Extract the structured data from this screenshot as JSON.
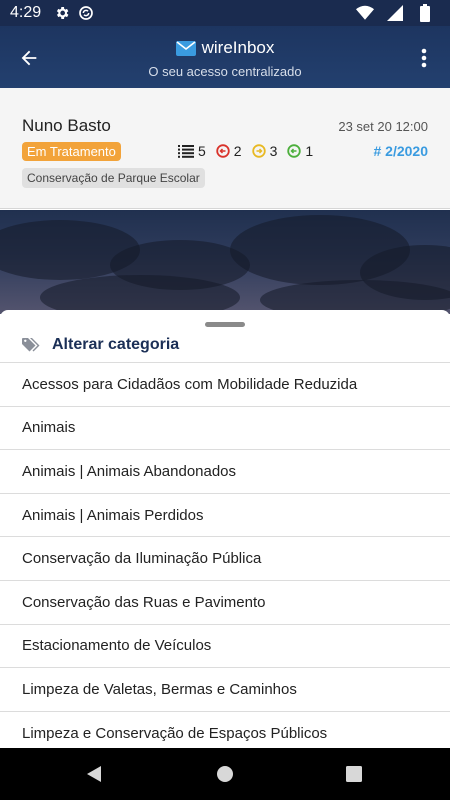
{
  "status_bar": {
    "time": "4:29"
  },
  "app_bar": {
    "title": "wireInbox",
    "subtitle": "O seu acesso centralizado"
  },
  "ticket": {
    "name": "Nuno Basto",
    "date": "23 set 20 12:00",
    "status": "Em Tratamento",
    "count_list": "5",
    "count_red": "2",
    "count_yellow": "3",
    "count_green": "1",
    "reference": "# 2/2020",
    "category": "Conservação de Parque Escolar",
    "colors": {
      "status": "#f2a33a",
      "reference": "#3a9be0",
      "red": "#d9332b",
      "yellow": "#e8b923",
      "green": "#4caf3c"
    }
  },
  "sheet": {
    "title": "Alterar categoria",
    "items": [
      "Acessos para Cidadãos com Mobilidade Reduzida",
      "Animais",
      "Animais | Animais Abandonados",
      "Animais | Animais Perdidos",
      "Conservação da Iluminação Pública",
      "Conservação das Ruas e Pavimento",
      "Estacionamento de Veículos",
      "Limpeza de Valetas, Bermas e Caminhos",
      "Limpeza e Conservação de Espaços Públicos"
    ]
  },
  "icons": {
    "status_bar": [
      "gear-icon",
      "sync-icon",
      "wifi-icon",
      "signal-icon",
      "battery-icon"
    ],
    "app_bar": [
      "back-arrow-icon",
      "envelope-icon",
      "more-vert-icon"
    ],
    "navigation": [
      "nav-back-icon",
      "nav-home-icon",
      "nav-recents-icon"
    ]
  }
}
